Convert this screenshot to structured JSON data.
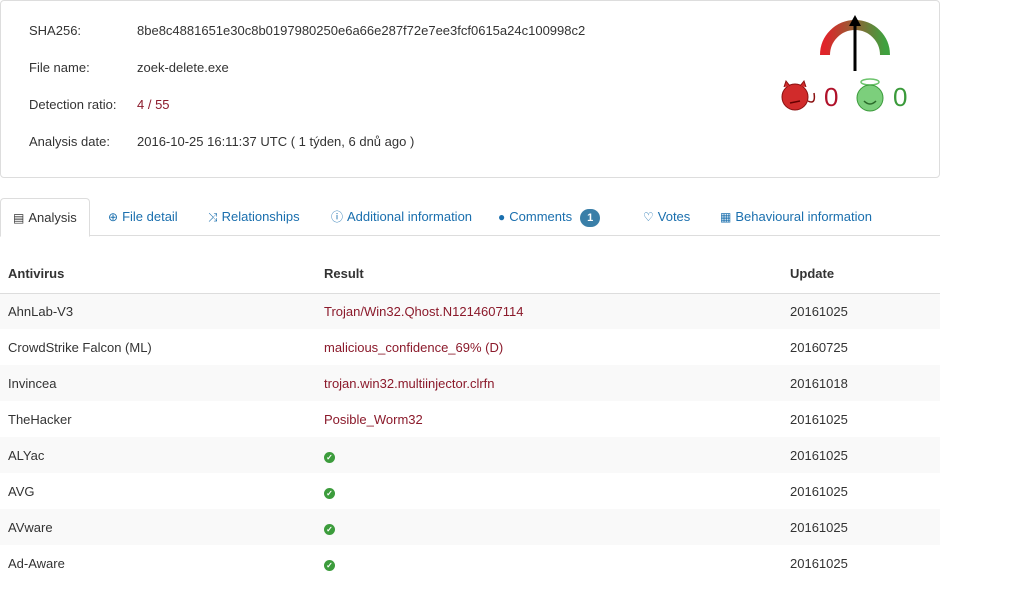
{
  "file": {
    "sha256_label": "SHA256:",
    "sha256": "8be8c4881651e30c8b0197980250e6a66e287f72e7ee3fcf0615a24c100998c2",
    "name_label": "File name:",
    "name": "zoek-delete.exe",
    "ratio_label": "Detection ratio:",
    "ratio": "4 / 55",
    "date_label": "Analysis date:",
    "date": "2016-10-25 16:11:37 UTC ( 1 týden, 6 dnů ago )"
  },
  "votes": {
    "malicious": "0",
    "harmless": "0"
  },
  "colors": {
    "malicious": "#b0122a",
    "harmless": "#3a9a3a",
    "link": "#1a6fae"
  },
  "tabs": [
    {
      "label": "Analysis",
      "icon": "list-icon"
    },
    {
      "label": "File detail",
      "icon": "search-plus-icon"
    },
    {
      "label": "Relationships",
      "icon": "shuffle-icon"
    },
    {
      "label": "Additional information",
      "icon": "info-icon"
    },
    {
      "label": "Comments",
      "icon": "comment-icon",
      "badge": "1"
    },
    {
      "label": "Votes",
      "icon": "thumbs-down-icon"
    },
    {
      "label": "Behavioural information",
      "icon": "film-icon"
    }
  ],
  "table": {
    "headers": [
      "Antivirus",
      "Result",
      "Update"
    ],
    "rows": [
      {
        "av": "AhnLab-V3",
        "result": "Trojan/Win32.Qhost.N1214607114",
        "update": "20161025"
      },
      {
        "av": "CrowdStrike Falcon (ML)",
        "result": "malicious_confidence_69% (D)",
        "update": "20160725"
      },
      {
        "av": "Invincea",
        "result": "trojan.win32.multiinjector.clrfn",
        "update": "20161018"
      },
      {
        "av": "TheHacker",
        "result": "Posible_Worm32",
        "update": "20161025"
      },
      {
        "av": "ALYac",
        "result": null,
        "update": "20161025"
      },
      {
        "av": "AVG",
        "result": null,
        "update": "20161025"
      },
      {
        "av": "AVware",
        "result": null,
        "update": "20161025"
      },
      {
        "av": "Ad-Aware",
        "result": null,
        "update": "20161025"
      }
    ]
  }
}
